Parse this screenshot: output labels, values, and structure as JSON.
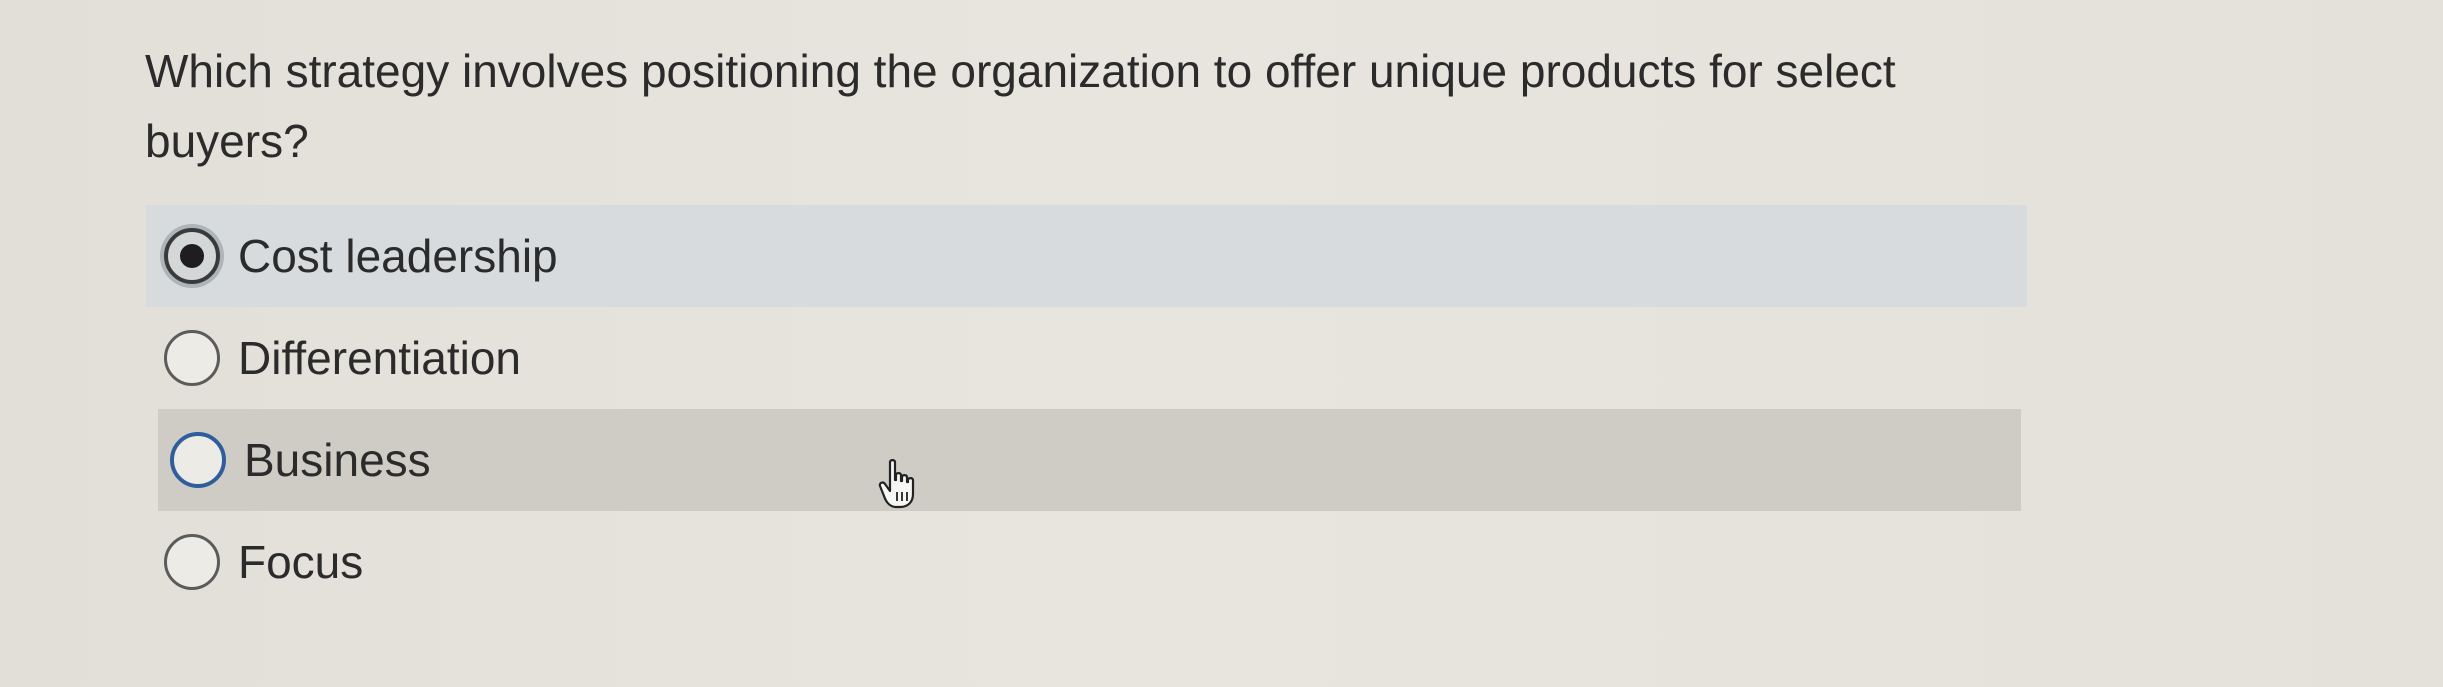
{
  "question": {
    "text": "Which strategy involves positioning the organization to offer unique products for select buyers?"
  },
  "options": [
    {
      "label": "Cost leadership",
      "checked": true
    },
    {
      "label": "Differentiation",
      "checked": false
    },
    {
      "label": "Business",
      "checked": false
    },
    {
      "label": "Focus",
      "checked": false
    }
  ],
  "colors": {
    "selected_row": "#d7dbdd",
    "hover_row": "#cfccc5",
    "focus_ring": "#2f5e9e",
    "text": "#2b2b2b"
  },
  "cursor": {
    "icon": "hand-pointer-icon"
  }
}
